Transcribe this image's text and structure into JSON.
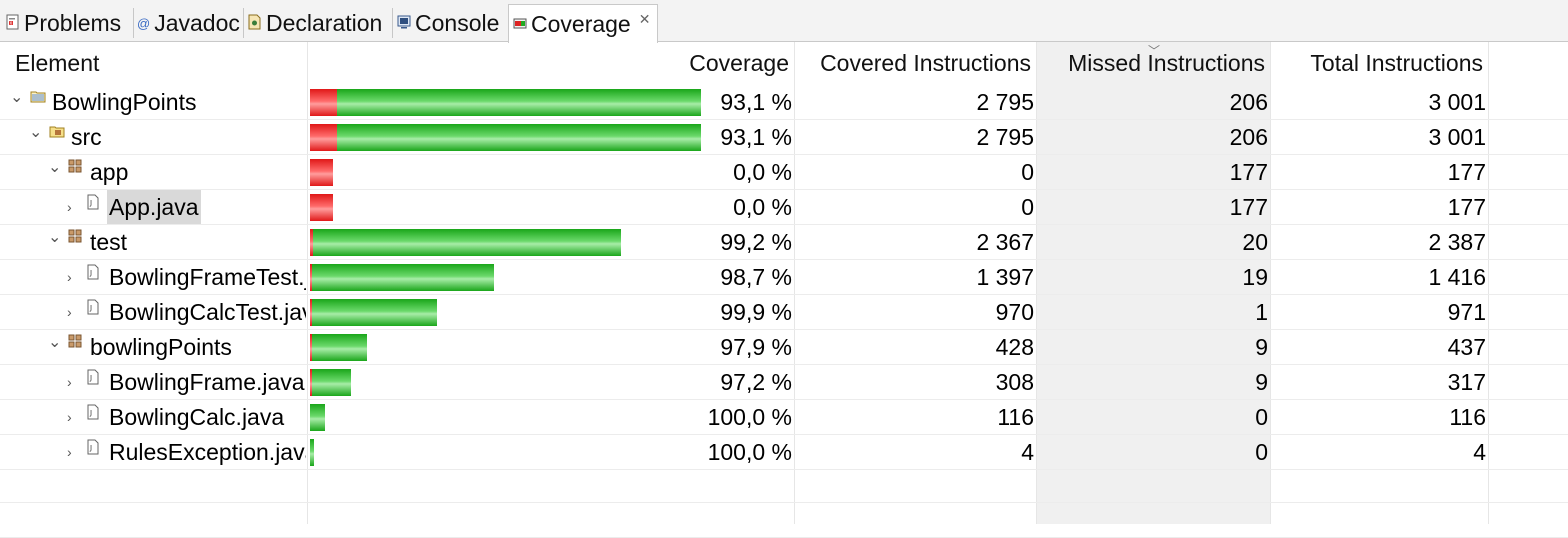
{
  "tabs": [
    {
      "label": "Problems",
      "icon": "problems-icon"
    },
    {
      "label": "Javadoc",
      "icon": "javadoc-icon"
    },
    {
      "label": "Declaration",
      "icon": "declaration-icon"
    },
    {
      "label": "Console",
      "icon": "console-icon"
    },
    {
      "label": "Coverage",
      "icon": "coverage-icon",
      "active": true
    }
  ],
  "columns": {
    "element": "Element",
    "coverage": "Coverage",
    "covered": "Covered Instructions",
    "missed": "Missed Instructions",
    "total": "Total Instructions"
  },
  "colors": {
    "covered": "#1aa61a",
    "missed": "#e01818"
  },
  "rows": [
    {
      "name": "BowlingPoints",
      "icon": "project-icon",
      "expanded": true,
      "coverage": "93,1 %",
      "covered": "2 795",
      "missed": "206",
      "total": "3 001",
      "covered_value": 2795,
      "missed_value": 206
    },
    {
      "name": "src",
      "icon": "source-folder-icon",
      "expanded": true,
      "coverage": "93,1 %",
      "covered": "2 795",
      "missed": "206",
      "total": "3 001",
      "covered_value": 2795,
      "missed_value": 206
    },
    {
      "name": "app",
      "icon": "package-icon",
      "expanded": true,
      "coverage": "0,0 %",
      "covered": "0",
      "missed": "177",
      "total": "177",
      "covered_value": 0,
      "missed_value": 177
    },
    {
      "name": "App.java",
      "icon": "java-file-icon",
      "expanded": false,
      "selected": true,
      "coverage": "0,0 %",
      "covered": "0",
      "missed": "177",
      "total": "177",
      "covered_value": 0,
      "missed_value": 177
    },
    {
      "name": "test",
      "icon": "package-icon",
      "expanded": true,
      "coverage": "99,2 %",
      "covered": "2 367",
      "missed": "20",
      "total": "2 387",
      "covered_value": 2367,
      "missed_value": 20
    },
    {
      "name": "BowlingFrameTest.java",
      "icon": "java-file-icon",
      "expanded": false,
      "coverage": "98,7 %",
      "covered": "1 397",
      "missed": "19",
      "total": "1 416",
      "covered_value": 1397,
      "missed_value": 19
    },
    {
      "name": "BowlingCalcTest.java",
      "icon": "java-file-icon",
      "expanded": false,
      "coverage": "99,9 %",
      "covered": "970",
      "missed": "1",
      "total": "971",
      "covered_value": 970,
      "missed_value": 1
    },
    {
      "name": "bowlingPoints",
      "icon": "package-icon",
      "expanded": true,
      "coverage": "97,9 %",
      "covered": "428",
      "missed": "9",
      "total": "437",
      "covered_value": 428,
      "missed_value": 9
    },
    {
      "name": "BowlingFrame.java",
      "icon": "java-file-icon",
      "expanded": false,
      "coverage": "97,2 %",
      "covered": "308",
      "missed": "9",
      "total": "317",
      "covered_value": 308,
      "missed_value": 9
    },
    {
      "name": "BowlingCalc.java",
      "icon": "java-file-icon",
      "expanded": false,
      "coverage": "100,0 %",
      "covered": "116",
      "missed": "0",
      "total": "116",
      "covered_value": 116,
      "missed_value": 0
    },
    {
      "name": "RulesException.java",
      "icon": "java-file-icon",
      "expanded": false,
      "coverage": "100,0 %",
      "covered": "4",
      "missed": "0",
      "total": "4",
      "covered_value": 4,
      "missed_value": 0
    }
  ]
}
